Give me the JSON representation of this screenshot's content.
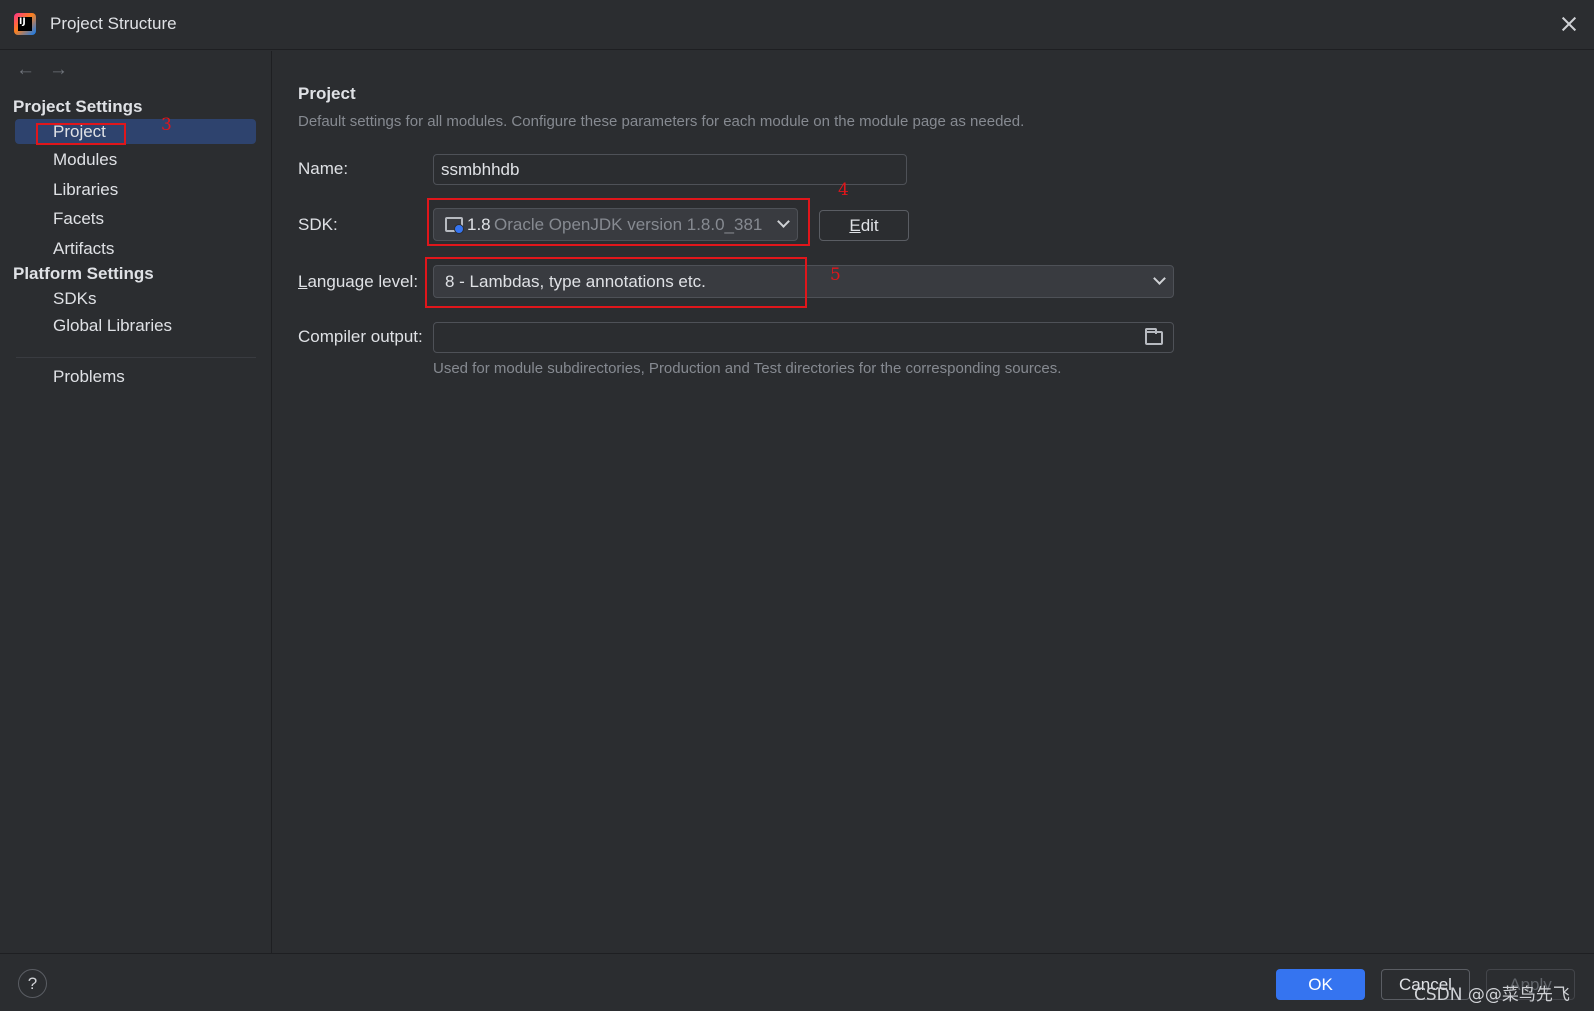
{
  "window": {
    "title": "Project Structure"
  },
  "sidebar": {
    "project_settings_heading": "Project Settings",
    "project_items": [
      "Project",
      "Modules",
      "Libraries",
      "Facets",
      "Artifacts"
    ],
    "platform_settings_heading": "Platform Settings",
    "platform_items": [
      "SDKs",
      "Global Libraries"
    ],
    "problems": "Problems"
  },
  "main": {
    "title": "Project",
    "description": "Default settings for all modules. Configure these parameters for each module on the module page as needed.",
    "name_label": "Name:",
    "name_value": "ssmbhhdb",
    "sdk_label": "SDK:",
    "sdk_version": "1.8",
    "sdk_name": "Oracle OpenJDK version 1.8.0_381",
    "edit_button": "Edit",
    "language_label_mnemonic": "L",
    "language_label_rest": "anguage level:",
    "language_value": "8 - Lambdas, type annotations etc.",
    "compiler_label": "Compiler output:",
    "compiler_value": "",
    "compiler_hint": "Used for module subdirectories, Production and Test directories for the corresponding sources."
  },
  "annotations": {
    "mark3": "3",
    "mark4": "4",
    "mark5": "5"
  },
  "footer": {
    "help": "?",
    "ok": "OK",
    "cancel": "Cancel",
    "apply": "Apply",
    "watermark": "CSDN @@菜鸟先飞"
  },
  "colors": {
    "accent": "#3574f0",
    "selection": "#2e436e",
    "annotation": "#e0161b",
    "background": "#2b2d30"
  }
}
